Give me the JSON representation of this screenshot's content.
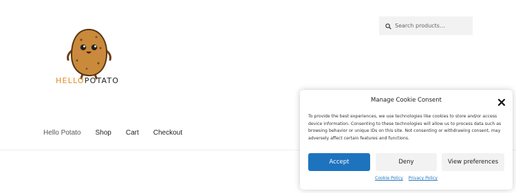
{
  "search": {
    "placeholder": "Search products…",
    "icon": "search-icon"
  },
  "logo": {
    "text_part1": "HELLO",
    "text_part2": "POTATO",
    "accent_color": "#e2891f"
  },
  "nav": {
    "items": [
      {
        "label": "Hello Potato"
      },
      {
        "label": "Shop"
      },
      {
        "label": "Cart"
      },
      {
        "label": "Checkout"
      }
    ]
  },
  "cookie_banner": {
    "title": "Manage Cookie Consent",
    "body": "To provide the best experiences, we use technologies like cookies to store and/or access device information. Consenting to these technologies will allow us to process data such as browsing behavior or unique IDs on this site. Not consenting or withdrawing consent, may adversely affect certain features and functions.",
    "accept_label": "Accept",
    "deny_label": "Deny",
    "preferences_label": "View preferences",
    "cookie_policy_label": "Cookie Policy",
    "privacy_policy_label": "Privacy Policy",
    "accent_color": "#1e73be"
  }
}
